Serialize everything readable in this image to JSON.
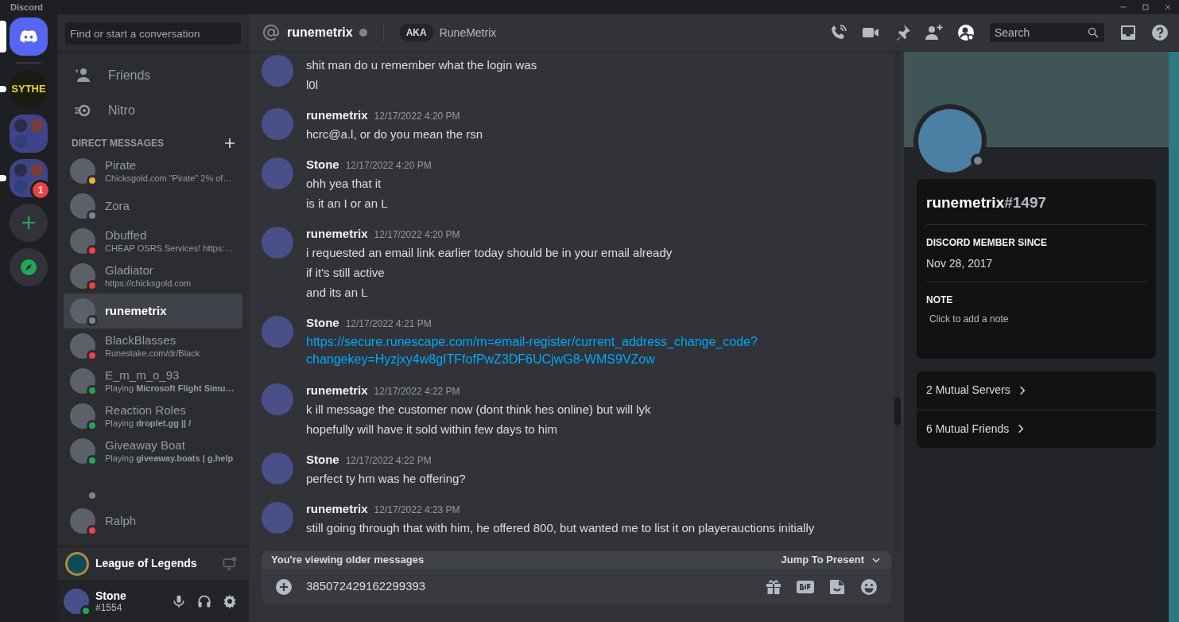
{
  "window": {
    "title": "Discord"
  },
  "servers": [
    {
      "kind": "home",
      "selected": true
    },
    {
      "kind": "server",
      "label": "SYTHE",
      "selected": false,
      "unread": true
    },
    {
      "kind": "folder",
      "selected": false,
      "unread": false
    },
    {
      "kind": "folder",
      "selected": false,
      "unread": true,
      "badge": "1"
    },
    {
      "kind": "add"
    },
    {
      "kind": "explore"
    }
  ],
  "dm_sidebar": {
    "search": {
      "placeholder": "Find or start a conversation"
    },
    "nav": [
      {
        "kind": "friends",
        "label": "Friends",
        "selected": false
      },
      {
        "kind": "nitro",
        "label": "Nitro",
        "selected": false
      }
    ],
    "section_title": "DIRECT MESSAGES",
    "conversations": [
      {
        "name": "Pirate",
        "activity": "Chicksgold.com \"Pirate\" 2% of…",
        "color": "#f0b232",
        "selected": false
      },
      {
        "name": "Zora",
        "color": "#80848e",
        "selected": false
      },
      {
        "name": "Dbuffed",
        "activity": "CHEAP OSRS Services! https:…",
        "color": "#f23f43",
        "selected": false
      },
      {
        "name": "Gladiator",
        "activity": "https://chicksgold.com",
        "color": "#f23f43",
        "selected": false
      },
      {
        "name": "runemetrix",
        "color": "#80848e",
        "selected": true
      },
      {
        "name": "BlackBlasses",
        "activity": "Runestake.com/dr/Black",
        "color": "#f23f43",
        "selected": false
      },
      {
        "name": "E_m_m_o_93",
        "activity": "Playing **Microsoft Flight Simu…**",
        "color": "#23a55a",
        "selected": false
      },
      {
        "name": "Reaction Roles",
        "activity": "Playing **droplet.gg || /**",
        "color": "#23a55a",
        "selected": false
      },
      {
        "name": "Giveaway Boat",
        "activity": "Playing **giveaway.boats | g.help**",
        "color": "#23a55a",
        "selected": false
      },
      {
        "color": "#80848e",
        "selected": false
      },
      {
        "name": "Ralph",
        "color": "#f23f43",
        "selected": false
      }
    ],
    "activity_panel": {
      "game": "League of Legends"
    },
    "user_panel": {
      "name": "Stone",
      "tag": "#1554",
      "status": {
        "color": "#23a55a"
      }
    }
  },
  "header": {
    "name": "runemetrix",
    "status": {
      "color": "#80848e"
    },
    "aka_label": "AKA",
    "aka_name": "RuneMetrix",
    "profile_shown": true,
    "search": {
      "placeholder": "Search"
    }
  },
  "messages": [
    {
      "lines": [
        {
          "kind": "text",
          "text": "shit man do u remember what the login was"
        },
        {
          "kind": "text",
          "text": "l0l"
        }
      ]
    },
    {
      "author": "runemetrix",
      "timestamp": "12/17/2022 4:20 PM",
      "lines": [
        {
          "kind": "text",
          "text": "hcrc@a.l, or do you mean the rsn"
        }
      ]
    },
    {
      "author": "Stone",
      "timestamp": "12/17/2022 4:20 PM",
      "lines": [
        {
          "kind": "text",
          "text": "ohh yea that it"
        },
        {
          "kind": "text",
          "text": "is it an I or an L"
        }
      ]
    },
    {
      "author": "runemetrix",
      "timestamp": "12/17/2022 4:20 PM",
      "lines": [
        {
          "kind": "text",
          "text": "i requested an email link earlier today should be in your email already"
        },
        {
          "kind": "text",
          "text": "if it's still active"
        },
        {
          "kind": "text",
          "text": "and its an L"
        }
      ]
    },
    {
      "author": "Stone",
      "timestamp": "12/17/2022 4:21 PM",
      "lines": [
        {
          "kind": "link",
          "text": "https://secure.runescape.com/m=email-register/current_address_change_code?changekey=Hyzjxy4w8gITFfofPwZ3DF6UCjwG8-WMS9VZow"
        }
      ]
    },
    {
      "author": "runemetrix",
      "timestamp": "12/17/2022 4:22 PM",
      "lines": [
        {
          "kind": "text",
          "text": "k ill message the customer now (dont think hes online) but will lyk"
        },
        {
          "kind": "text",
          "text": "hopefully will have it sold within few days to him"
        }
      ]
    },
    {
      "author": "Stone",
      "timestamp": "12/17/2022 4:22 PM",
      "lines": [
        {
          "kind": "text",
          "text": "perfect ty hm was he offering?"
        }
      ]
    },
    {
      "author": "runemetrix",
      "timestamp": "12/17/2022 4:23 PM",
      "lines": [
        {
          "kind": "text",
          "text": "still going through that with him, he offered 800, but wanted me to list it on playerauctions initially"
        }
      ]
    }
  ],
  "jump_bar": {
    "text": "You're viewing older messages",
    "action": "Jump To Present"
  },
  "composer": {
    "value": "385072429162299393"
  },
  "profile": {
    "username": "runemetrix",
    "discriminator": "#1497",
    "status": {
      "color": "#80848e"
    },
    "member_since_label": "DISCORD MEMBER SINCE",
    "member_since": "Nov 28, 2017",
    "note_label": "NOTE",
    "note_placeholder": "Click to add a note",
    "mutuals": [
      "2 Mutual Servers",
      "6 Mutual Friends"
    ]
  }
}
